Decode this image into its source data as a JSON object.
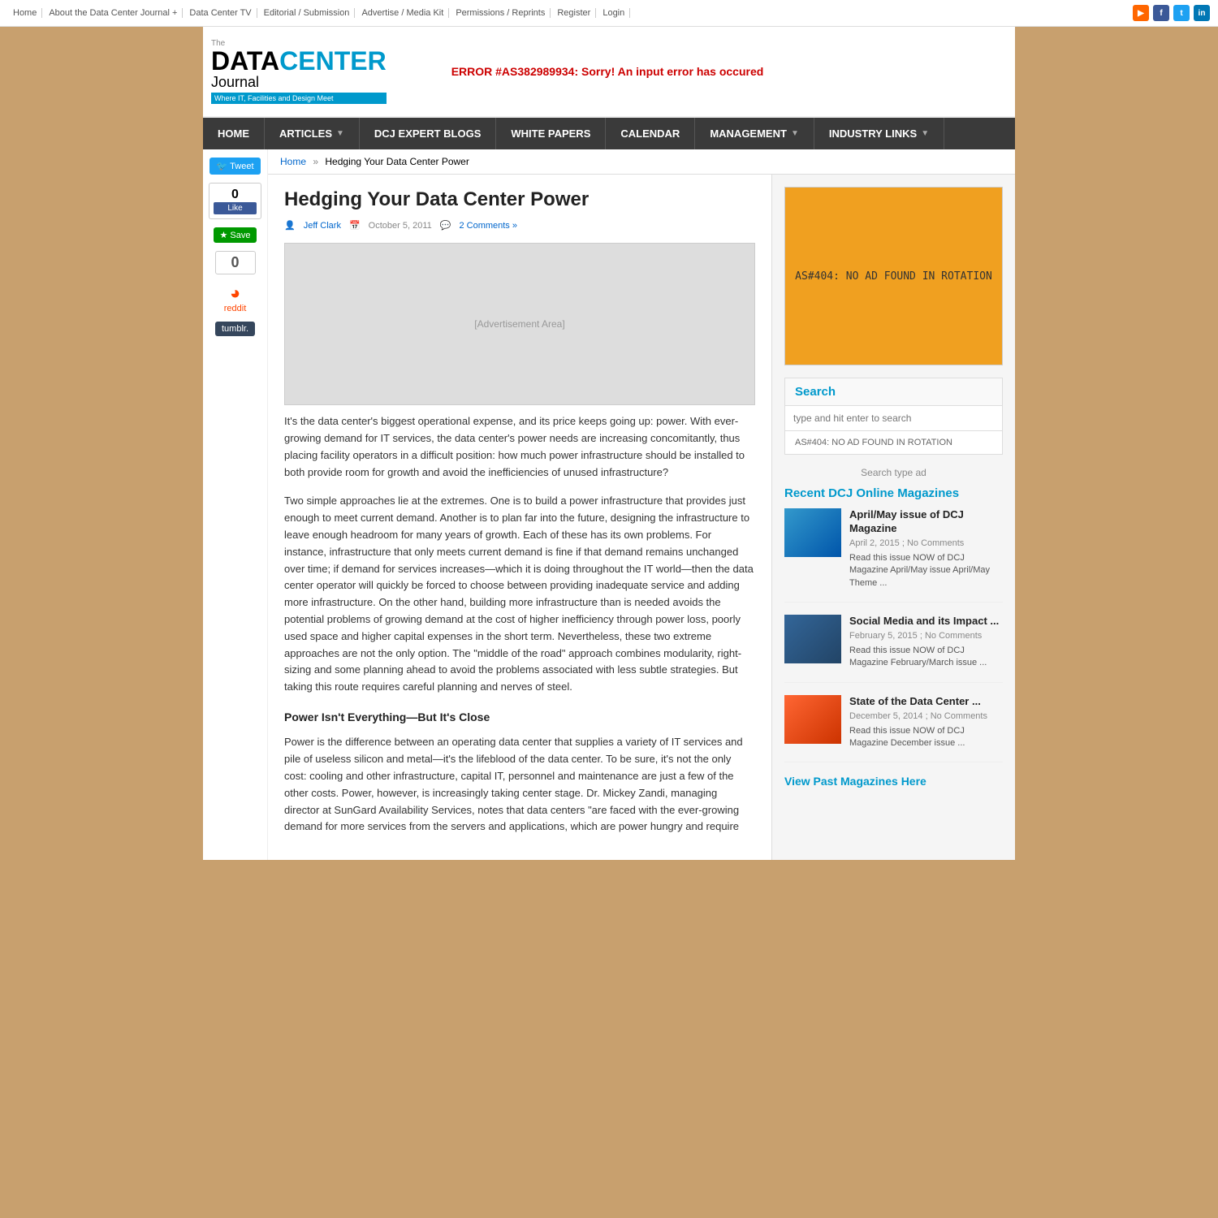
{
  "topnav": {
    "items": [
      {
        "label": "Home",
        "href": "#"
      },
      {
        "label": "About the Data Center Journal +",
        "href": "#"
      },
      {
        "label": "Data Center TV",
        "href": "#"
      },
      {
        "label": "Editorial / Submission",
        "href": "#"
      },
      {
        "label": "Advertise / Media Kit",
        "href": "#"
      },
      {
        "label": "Permissions / Reprints",
        "href": "#"
      },
      {
        "label": "Register",
        "href": "#"
      },
      {
        "label": "Login",
        "href": "#"
      }
    ],
    "social": [
      {
        "name": "rss",
        "label": "RSS"
      },
      {
        "name": "facebook",
        "label": "f"
      },
      {
        "name": "twitter",
        "label": "t"
      },
      {
        "name": "linkedin",
        "label": "in"
      }
    ]
  },
  "header": {
    "logo_top": "The",
    "logo_data": "DATA",
    "logo_center": "CENTER",
    "logo_journal": "Journal",
    "logo_tagline": "Where IT, Facilities and Design Meet",
    "error_message": "ERROR #AS382989934: Sorry! An input error has occured"
  },
  "mainnav": {
    "items": [
      {
        "label": "HOME",
        "has_arrow": false
      },
      {
        "label": "ARTICLES",
        "has_arrow": true
      },
      {
        "label": "DCJ EXPERT BLOGS",
        "has_arrow": false
      },
      {
        "label": "WHITE PAPERS",
        "has_arrow": false
      },
      {
        "label": "CALENDAR",
        "has_arrow": false
      },
      {
        "label": "MANAGEMENT",
        "has_arrow": true
      },
      {
        "label": "INDUSTRY LINKS",
        "has_arrow": true
      }
    ]
  },
  "sidebar_left": {
    "tweet_label": "Tweet",
    "like_count": "0",
    "like_btn_label": "Like",
    "save_label": "Save",
    "share_count": "0",
    "reddit_label": "reddit",
    "tumblr_label": "tumblr."
  },
  "breadcrumb": {
    "home_label": "Home",
    "separator": "»",
    "current": "Hedging Your Data Center Power"
  },
  "article": {
    "title": "Hedging Your Data Center Power",
    "author": "Jeff Clark",
    "date": "October 5, 2011",
    "comments": "2 Comments »",
    "body_paragraphs": [
      "It's the data center's biggest operational expense, and its price keeps going up: power. With ever-growing demand for IT services, the data center's power needs are increasing concomitantly, thus placing facility operators in a difficult position: how much power infrastructure should be installed to both provide room for growth and avoid the inefficiencies of unused infrastructure?",
      "Two simple approaches lie at the extremes. One is to build a power infrastructure that provides just enough to meet current demand. Another is to plan far into the future, designing the infrastructure to leave enough headroom for many years of growth. Each of these has its own problems. For instance, infrastructure that only meets current demand is fine if that demand remains unchanged over time; if demand for services increases—which it is doing throughout the IT world—then the data center operator will quickly be forced to choose between providing inadequate service and adding more infrastructure. On the other hand, building more infrastructure than is needed avoids the potential problems of growing demand at the cost of higher inefficiency through power loss, poorly used space and higher capital expenses in the short term. Nevertheless, these two extreme approaches are not the only option. The \"middle of the road\" approach combines modularity, right-sizing and some planning ahead to avoid the problems associated with less subtle strategies. But taking this route requires careful planning and nerves of steel.",
      "Power Isn't Everything—But It's Close",
      "Power is the difference between an operating data center that supplies a variety of IT services and pile of useless silicon and metal—it's the lifeblood of the data center. To be sure, it's not the only cost: cooling and other infrastructure, capital IT, personnel and maintenance are just a few of the other costs. Power, however, is increasingly taking center stage. Dr. Mickey Zandi, managing director at SunGard Availability Services, notes that data centers \"are faced with the ever-growing demand for more services from the servers and applications, which are power hungry and require"
    ],
    "subheading": "Power Isn't Everything—But It's Close"
  },
  "right_sidebar": {
    "ad_text": "AS#404: NO AD FOUND IN ROTATION",
    "search_widget": {
      "title": "Search",
      "placeholder": "type and hit enter to search",
      "ad_text": "AS#404: NO AD FOUND IN ROTATION"
    },
    "search_ad_label": "Search type ad",
    "magazines_title": "Recent DCJ Online Magazines",
    "magazines": [
      {
        "title": "April/May issue of DCJ Magazine",
        "date": "April 2, 2015",
        "date_suffix": "No Comments",
        "excerpt": "Read this issue NOW of DCJ Magazine April/May issue April/May Theme ...",
        "thumb_type": "blue"
      },
      {
        "title": "Social Media and its Impact ...",
        "date": "February 5, 2015",
        "date_suffix": "No Comments",
        "excerpt": "Read this issue NOW of DCJ Magazine February/March issue ...",
        "thumb_type": "social"
      },
      {
        "title": "State of the Data Center ...",
        "date": "December 5, 2014",
        "date_suffix": "No Comments",
        "excerpt": "Read this issue NOW of DCJ Magazine December issue ...",
        "thumb_type": "disaster"
      }
    ],
    "view_past_label": "View Past Magazines Here"
  }
}
